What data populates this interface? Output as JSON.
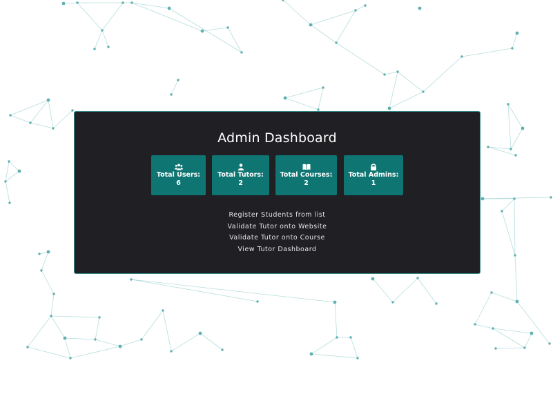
{
  "dashboard": {
    "title": "Admin Dashboard",
    "stats": [
      {
        "label": "Total Users:",
        "value": "6",
        "icon": "users-icon"
      },
      {
        "label": "Total Tutors:",
        "value": "2",
        "icon": "user-icon"
      },
      {
        "label": "Total Courses:",
        "value": "2",
        "icon": "book-icon"
      },
      {
        "label": "Total Admins:",
        "value": "1",
        "icon": "lock-icon"
      }
    ],
    "links": [
      "Register Students from list",
      "Validate Tutor onto Website",
      "Validate Tutor onto Course",
      "View Tutor Dashboard"
    ]
  },
  "theme": {
    "panel_bg": "#1f1f24",
    "card_bg": "#0f7572",
    "network_color": "#5fb3b3"
  }
}
